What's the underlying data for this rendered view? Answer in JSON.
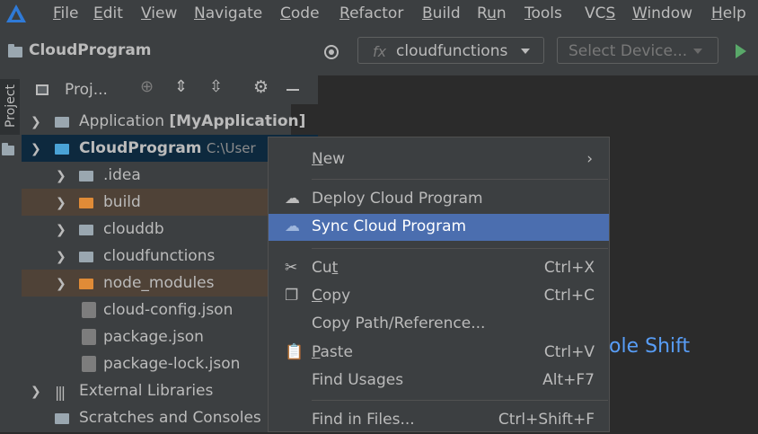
{
  "menubar": {
    "items": [
      {
        "pre": "",
        "mn": "F",
        "post": "ile"
      },
      {
        "pre": "",
        "mn": "E",
        "post": "dit"
      },
      {
        "pre": "",
        "mn": "V",
        "post": "iew"
      },
      {
        "pre": "",
        "mn": "N",
        "post": "avigate"
      },
      {
        "pre": "",
        "mn": "C",
        "post": "ode"
      },
      {
        "pre": "",
        "mn": "R",
        "post": "efactor"
      },
      {
        "pre": "",
        "mn": "B",
        "post": "uild"
      },
      {
        "pre": "R",
        "mn": "u",
        "post": "n"
      },
      {
        "pre": "",
        "mn": "T",
        "post": "ools"
      },
      {
        "pre": "VC",
        "mn": "S",
        "post": ""
      },
      {
        "pre": "",
        "mn": "W",
        "post": "indow"
      },
      {
        "pre": "",
        "mn": "H",
        "post": "elp"
      }
    ]
  },
  "navbar": {
    "project_title": "CloudProgram",
    "fx_label": "fx",
    "config_combo": "cloudfunctions",
    "device_combo": "Select Device..."
  },
  "side_tab": "Project",
  "project_panel": {
    "title": "Proj...",
    "rows": [
      {
        "name": "Application",
        "bold": "[MyApplication]"
      },
      {
        "name": "CloudProgram",
        "path": "C:\\User"
      },
      {
        "name": ".idea"
      },
      {
        "name": "build"
      },
      {
        "name": "clouddb"
      },
      {
        "name": "cloudfunctions"
      },
      {
        "name": "node_modules"
      },
      {
        "name": "cloud-config.json"
      },
      {
        "name": "package.json"
      },
      {
        "name": "package-lock.json"
      },
      {
        "name": "External Libraries"
      },
      {
        "name": "Scratches and Consoles"
      }
    ]
  },
  "editor_hint": "ole Shift",
  "context_menu": {
    "new": {
      "mn": "N",
      "rest": "ew"
    },
    "deploy": "Deploy Cloud Program",
    "sync": "Sync Cloud Program",
    "cut": {
      "pre": "Cu",
      "mn": "t",
      "shortcut": "Ctrl+X"
    },
    "copy": {
      "mn": "C",
      "rest": "opy",
      "shortcut": "Ctrl+C"
    },
    "copy_path": "Copy Path/Reference...",
    "paste": {
      "mn": "P",
      "rest": "aste",
      "shortcut": "Ctrl+V"
    },
    "find_usages": {
      "label": "Find Usages",
      "shortcut": "Alt+F7"
    },
    "find_in_files": {
      "label": "Find in Files...",
      "shortcut": "Ctrl+Shift+F"
    }
  },
  "colors": {
    "selection": "#4b6eaf",
    "run_green": "#59a869",
    "hint_blue": "#589df6"
  }
}
